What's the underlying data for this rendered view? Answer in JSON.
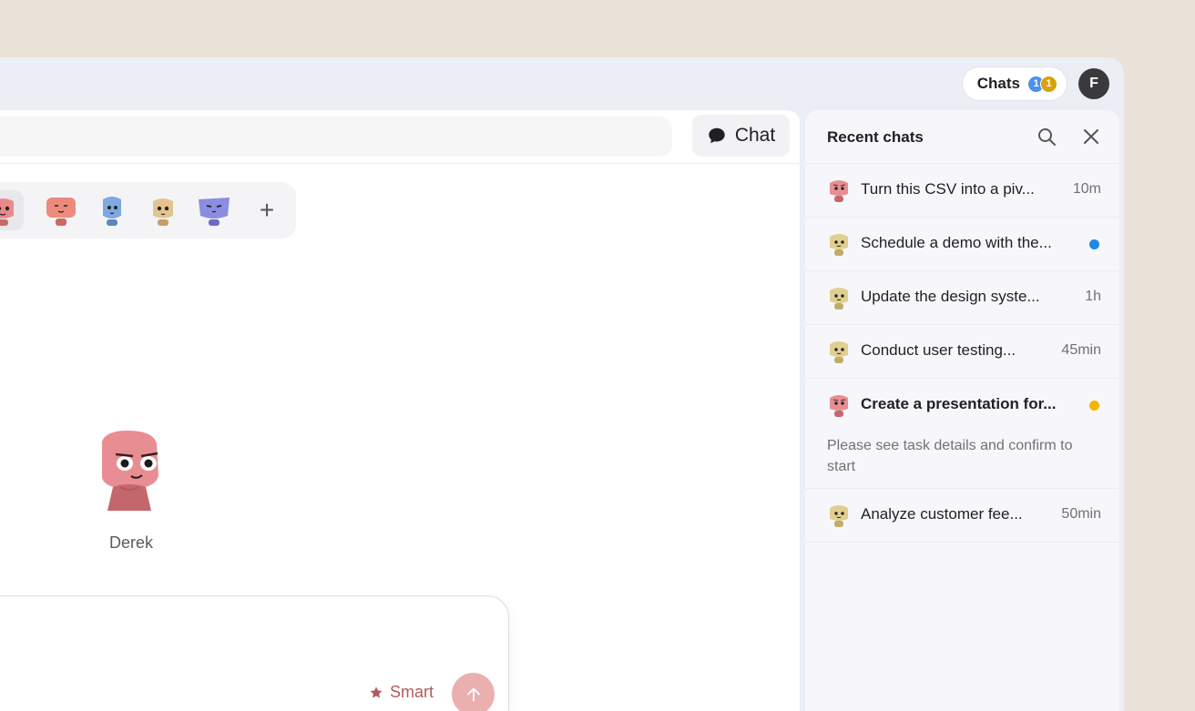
{
  "header": {
    "chats_label": "Chats",
    "badge_blue": "1",
    "badge_gold": "1",
    "user_initial": "F"
  },
  "main": {
    "chat_button_label": "Chat",
    "agent_name": "Derek",
    "smart_label": "Smart"
  },
  "panel": {
    "title": "Recent chats",
    "chats": [
      {
        "title": "Turn this CSV into a piv...",
        "time": "10m",
        "avatar": "pink-agent"
      },
      {
        "title": "Schedule a demo with the...",
        "dot_color": "#1e88e5",
        "avatar": "tan-agent"
      },
      {
        "title": "Update the design syste...",
        "time": "1h",
        "avatar": "tan-agent"
      },
      {
        "title": "Conduct user testing...",
        "time": "45min",
        "avatar": "tan-agent"
      },
      {
        "title": "Create a presentation for...",
        "dot_color": "#f5b400",
        "subtitle": "Please see task details and confirm to start",
        "avatar": "pink-agent"
      },
      {
        "title": "Analyze customer fee...",
        "time": "50min",
        "avatar": "tan-agent"
      }
    ]
  },
  "colors": {
    "background": "#e9e2d8",
    "accent_red": "#b55858",
    "send_disabled": "#eab0b0"
  }
}
